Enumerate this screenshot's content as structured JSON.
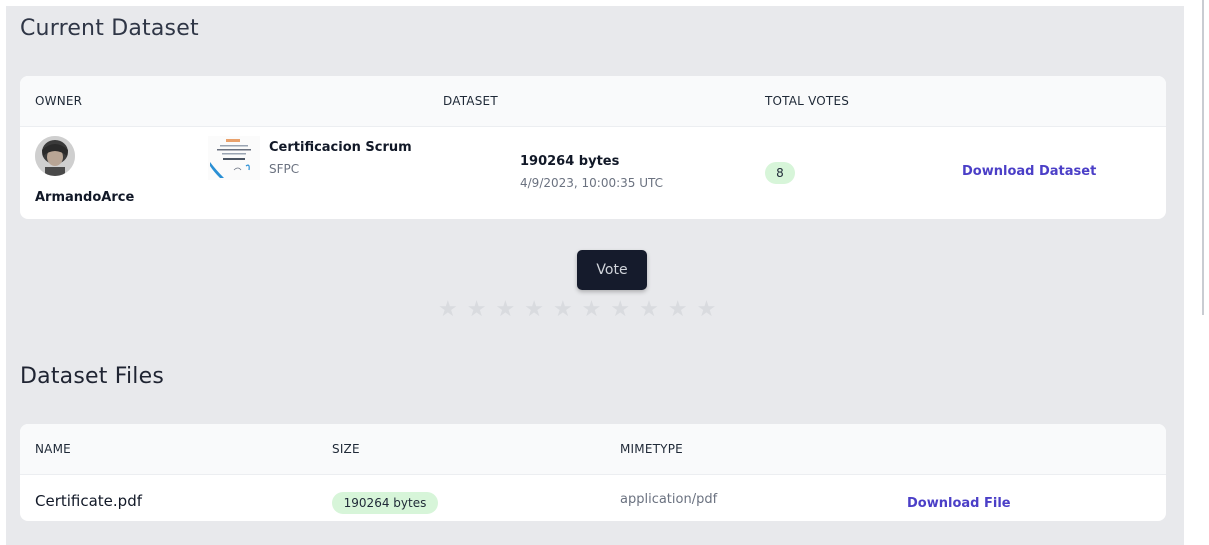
{
  "current_dataset": {
    "title": "Current Dataset",
    "columns": {
      "owner": "OWNER",
      "dataset": "DATASET",
      "total_votes": "TOTAL VOTES"
    },
    "row": {
      "owner_name": "ArmandoArce",
      "dataset_name": "Certificacion Scrum",
      "dataset_org": "SFPC",
      "size": "190264 bytes",
      "date": "4/9/2023, 10:00:35 UTC",
      "votes": "8",
      "download_label": "Download Dataset"
    }
  },
  "vote": {
    "button_label": "Vote",
    "stars": {
      "total": 10,
      "filled": 0,
      "icon": "star-icon"
    }
  },
  "dataset_files": {
    "title": "Dataset Files",
    "columns": {
      "name": "NAME",
      "size": "SIZE",
      "mimetype": "MIMETYPE"
    },
    "rows": [
      {
        "name": "Certificate.pdf",
        "size": "190264 bytes",
        "mimetype": "application/pdf",
        "download_label": "Download File"
      }
    ]
  },
  "colors": {
    "background": "#e8e9ec",
    "card": "#ffffff",
    "link": "#4b3fc7",
    "badge": "#d7f5d9",
    "vote_button": "#151b2c",
    "star_empty": "#d9dbdf"
  }
}
